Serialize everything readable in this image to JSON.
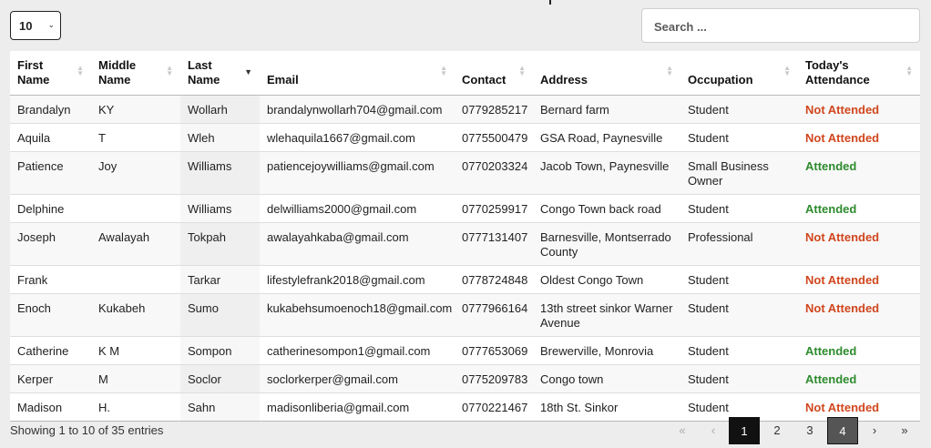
{
  "controls": {
    "length_value": "10",
    "search_placeholder": "Search ..."
  },
  "table": {
    "headers": {
      "first_name_1": "First",
      "first_name_2": "Name",
      "middle_name_1": "Middle",
      "middle_name_2": "Name",
      "last_name_1": "Last",
      "last_name_2": "Name",
      "email": "Email",
      "contact": "Contact",
      "address": "Address",
      "occupation": "Occupation",
      "attendance_1": "Today's",
      "attendance_2": "Attendance"
    },
    "rows": [
      {
        "first": "Brandalyn",
        "middle": "KY",
        "last": "Wollarh",
        "email": "brandalynwollarh704@gmail.com",
        "contact": "0779285217",
        "address": "Bernard farm",
        "occupation": "Student",
        "attendance": "Not Attended"
      },
      {
        "first": "Aquila",
        "middle": "T",
        "last": "Wleh",
        "email": "wlehaquila1667@gmail.com",
        "contact": "0775500479",
        "address": "GSA Road, Paynesville",
        "occupation": "Student",
        "attendance": "Not Attended"
      },
      {
        "first": "Patience",
        "middle": "Joy",
        "last": "Williams",
        "email": "patiencejoywilliams@gmail.com",
        "contact": "0770203324",
        "address": "Jacob Town, Paynesville",
        "occupation": "Small Business Owner",
        "attendance": "Attended"
      },
      {
        "first": "Delphine",
        "middle": "",
        "last": "Williams",
        "email": "delwilliams2000@gmail.com",
        "contact": "0770259917",
        "address": "Congo Town back road",
        "occupation": "Student",
        "attendance": "Attended"
      },
      {
        "first": "Joseph",
        "middle": "Awalayah",
        "last": "Tokpah",
        "email": "awalayahkaba@gmail.com",
        "contact": "0777131407",
        "address": "Barnesville, Montserrado County",
        "occupation": "Professional",
        "attendance": "Not Attended"
      },
      {
        "first": "Frank",
        "middle": "",
        "last": "Tarkar",
        "email": "lifestylefrank2018@gmail.com",
        "contact": "0778724848",
        "address": "Oldest Congo Town",
        "occupation": "Student",
        "attendance": "Not Attended"
      },
      {
        "first": "Enoch",
        "middle": "Kukabeh",
        "last": "Sumo",
        "email": "kukabehsumoenoch18@gmail.com",
        "contact": "0777966164",
        "address": "13th street sinkor Warner Avenue",
        "occupation": "Student",
        "attendance": "Not Attended"
      },
      {
        "first": "Catherine",
        "middle": "K M",
        "last": "Sompon",
        "email": "catherinesompon1@gmail.com",
        "contact": "0777653069",
        "address": "Brewerville, Monrovia",
        "occupation": "Student",
        "attendance": "Attended"
      },
      {
        "first": "Kerper",
        "middle": "M",
        "last": "Soclor",
        "email": "soclorkerper@gmail.com",
        "contact": "0775209783",
        "address": "Congo town",
        "occupation": "Student",
        "attendance": "Attended"
      },
      {
        "first": "Madison",
        "middle": "H.",
        "last": "Sahn",
        "email": "madisonliberia@gmail.com",
        "contact": "0770221467",
        "address": "18th St. Sinkor",
        "occupation": "Student",
        "attendance": "Not Attended"
      }
    ]
  },
  "footer": {
    "info": "Showing 1 to 10 of 35 entries",
    "first": "«",
    "prev": "‹",
    "pages": [
      "1",
      "2",
      "3",
      "4"
    ],
    "next": "›",
    "last": "»"
  },
  "colors": {
    "not_attended": "#d0461d",
    "attended": "#2e8b2e"
  }
}
